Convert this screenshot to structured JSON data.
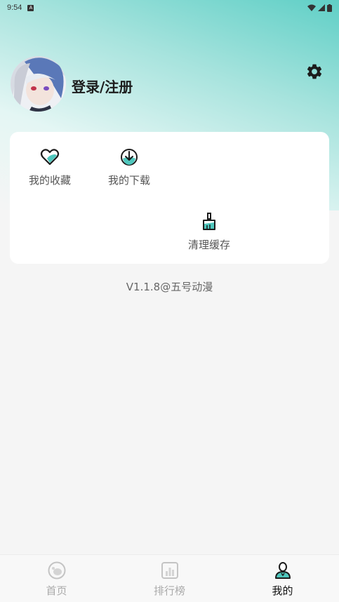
{
  "status_bar": {
    "time": "9:54",
    "notification_icon": "A"
  },
  "profile": {
    "login_label": "登录/注册"
  },
  "quick_actions": [
    {
      "label": "我的收藏",
      "icon": "heart-icon"
    },
    {
      "label": "我的下载",
      "icon": "download-icon"
    },
    {
      "label": "清理缓存",
      "icon": "broom-icon"
    }
  ],
  "version_text": "V1.1.8@五号动漫",
  "tabs": [
    {
      "label": "首页",
      "icon": "home-icon",
      "active": false
    },
    {
      "label": "排行榜",
      "icon": "ranking-icon",
      "active": false
    },
    {
      "label": "我的",
      "icon": "profile-icon",
      "active": true
    }
  ],
  "colors": {
    "accent": "#4fc7bd",
    "dark": "#1c1c1c",
    "muted": "#aaaaaa"
  }
}
